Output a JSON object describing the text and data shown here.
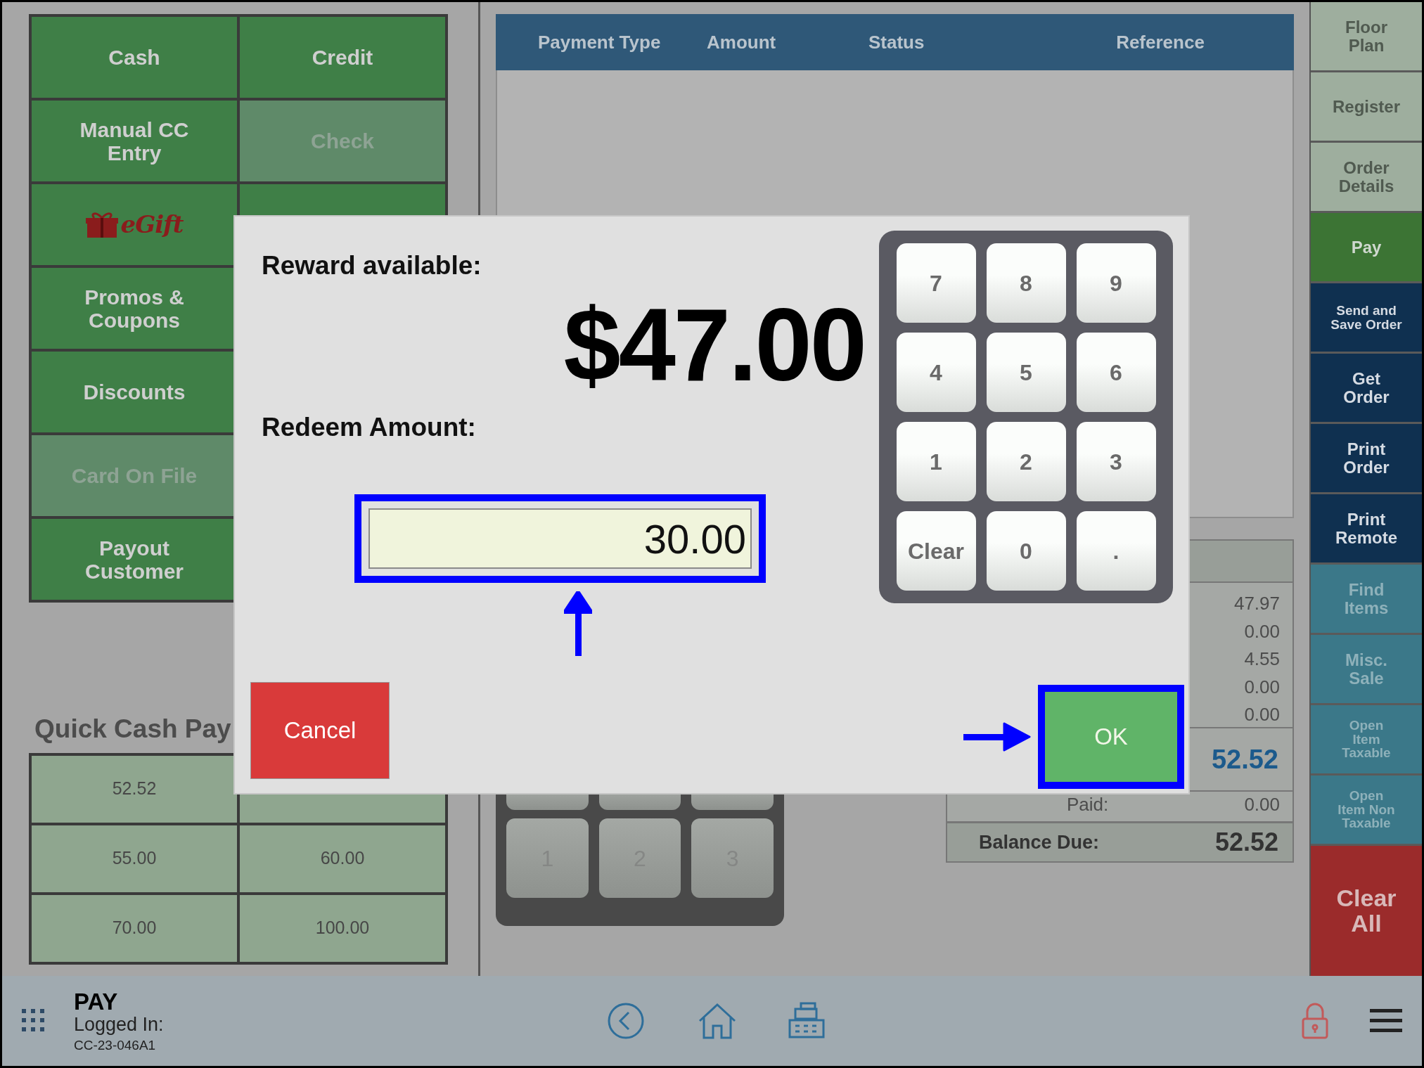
{
  "payment_buttons": [
    {
      "kind": "text",
      "label": "Cash",
      "disabled": false
    },
    {
      "kind": "text",
      "label": "Credit",
      "disabled": false
    },
    {
      "kind": "text",
      "label": "Manual CC Entry",
      "disabled": false
    },
    {
      "kind": "text",
      "label": "Check",
      "disabled": true
    },
    {
      "kind": "egift",
      "label": "eGift",
      "disabled": false
    },
    {
      "kind": "covered"
    },
    {
      "kind": "text",
      "label": "Promos & Coupons",
      "disabled": false
    },
    {
      "kind": "text",
      "label": "Discounts",
      "disabled": false
    },
    {
      "kind": "text",
      "label": "Card On File",
      "disabled": true
    },
    {
      "kind": "text",
      "label": "Payout Customer",
      "disabled": false
    }
  ],
  "quick_cash": {
    "title": "Quick Cash Pay",
    "buttons": [
      {
        "kind": "amount",
        "label": "52.52"
      },
      {
        "kind": "covered"
      },
      {
        "kind": "amount",
        "label": "55.00"
      },
      {
        "kind": "amount",
        "label": "60.00"
      },
      {
        "kind": "amount",
        "label": "70.00"
      },
      {
        "kind": "amount",
        "label": "100.00"
      }
    ]
  },
  "payments_table": {
    "columns": [
      "Payment Type",
      "Amount",
      "Status",
      "Reference"
    ]
  },
  "background_keypad": [
    {
      "kind": "covered"
    },
    {
      "kind": "covered"
    },
    {
      "kind": "covered"
    },
    {
      "kind": "key",
      "label": "1"
    },
    {
      "kind": "key",
      "label": "2"
    },
    {
      "kind": "key",
      "label": "3"
    }
  ],
  "summary": {
    "values": [
      "47.97",
      "0.00",
      "4.55",
      "0.00",
      "0.00"
    ],
    "total": "52.52",
    "paid": {
      "label": "Paid:",
      "value": "0.00"
    },
    "balance": {
      "label": "Balance Due:",
      "value": "52.52"
    }
  },
  "nav": [
    {
      "kind": "screen",
      "label": "Floor Plan",
      "selected": false
    },
    {
      "kind": "screen",
      "label": "Register",
      "selected": false
    },
    {
      "kind": "screen",
      "label": "Order Details",
      "selected": false
    },
    {
      "kind": "screen",
      "label": "Pay",
      "selected": true
    },
    {
      "kind": "order-small",
      "label": "Send and Save Order",
      "selected": false
    },
    {
      "kind": "order",
      "label": "Get Order",
      "selected": false
    },
    {
      "kind": "order",
      "label": "Print Order",
      "selected": false
    },
    {
      "kind": "order",
      "label": "Print Remote",
      "selected": false
    },
    {
      "kind": "item",
      "label": "Find Items",
      "selected": false
    },
    {
      "kind": "item",
      "label": "Misc. Sale",
      "selected": false
    },
    {
      "kind": "item-small",
      "label": "Open Item Taxable",
      "selected": false
    },
    {
      "kind": "item-small",
      "label": "Open Item Non Taxable",
      "selected": false
    },
    {
      "kind": "danger",
      "label": "Clear All",
      "selected": false
    }
  ],
  "footer": {
    "title": "PAY",
    "logged_in": "Logged In:",
    "user": "CC-23-046A1"
  },
  "dialog": {
    "reward_label": "Reward available:",
    "reward_amount": "$47.00",
    "redeem_label": "Redeem Amount:",
    "redeem_field": {
      "value": "30.00",
      "highlighted": true
    },
    "keypad": [
      "7",
      "8",
      "9",
      "4",
      "5",
      "6",
      "1",
      "2",
      "3",
      "Clear",
      "0",
      "."
    ],
    "cancel": {
      "label": "Cancel"
    },
    "ok": {
      "label": "OK",
      "highlighted": true
    }
  }
}
